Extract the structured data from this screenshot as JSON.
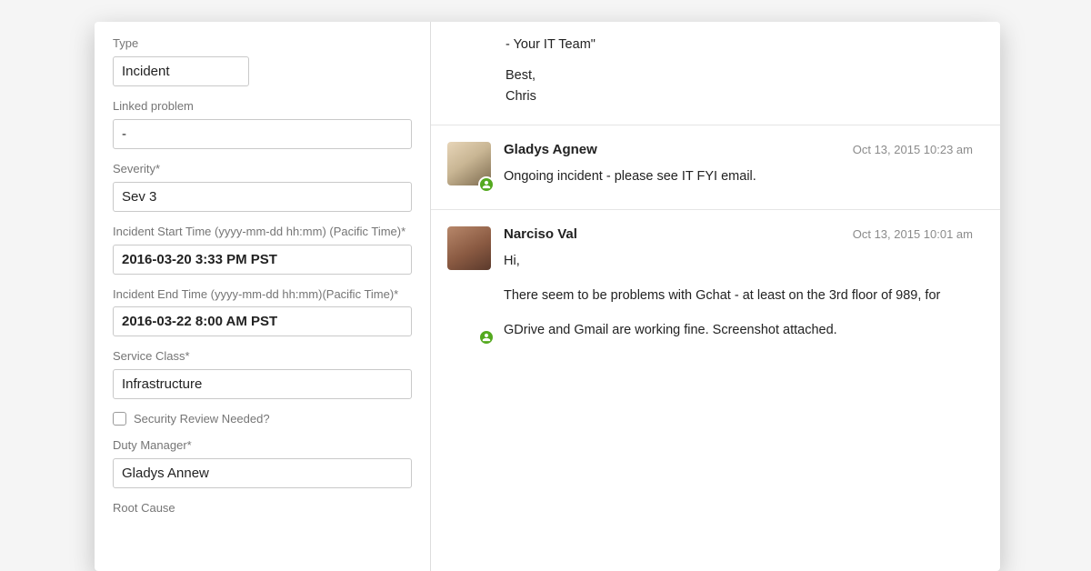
{
  "form": {
    "type": {
      "label": "Type",
      "value": "Incident"
    },
    "linked_problem": {
      "label": "Linked problem",
      "value": "-"
    },
    "severity": {
      "label": "Severity*",
      "value": "Sev 3"
    },
    "incident_start": {
      "label": "Incident Start Time (yyyy-mm-dd hh:mm) (Pacific Time)*",
      "value": "2016-03-20 3:33 PM PST"
    },
    "incident_end": {
      "label": "Incident End Time (yyyy-mm-dd hh:mm)(Pacific Time)*",
      "value": "2016-03-22 8:00 AM PST"
    },
    "service_class": {
      "label": "Service Class*",
      "value": "Infrastructure"
    },
    "security_review": {
      "label": "Security Review Needed?",
      "checked": false
    },
    "duty_manager": {
      "label": "Duty Manager*",
      "value": "Gladys Annew"
    },
    "root_cause": {
      "label": "Root Cause"
    }
  },
  "conversation": {
    "top": {
      "line1": "- Your IT Team\"",
      "line2": "Best,",
      "line3": "Chris"
    },
    "messages": [
      {
        "author": "Gladys Agnew",
        "time": "Oct 13, 2015 10:23 am",
        "body1": "Ongoing incident - please see IT FYI email."
      },
      {
        "author": "Narciso Val",
        "time": "Oct 13, 2015 10:01 am",
        "body1": "Hi,",
        "body2": "There seem to be problems with Gchat - at least on the 3rd floor of 989, for",
        "body3": "GDrive and Gmail are working fine. Screenshot attached."
      }
    ]
  }
}
